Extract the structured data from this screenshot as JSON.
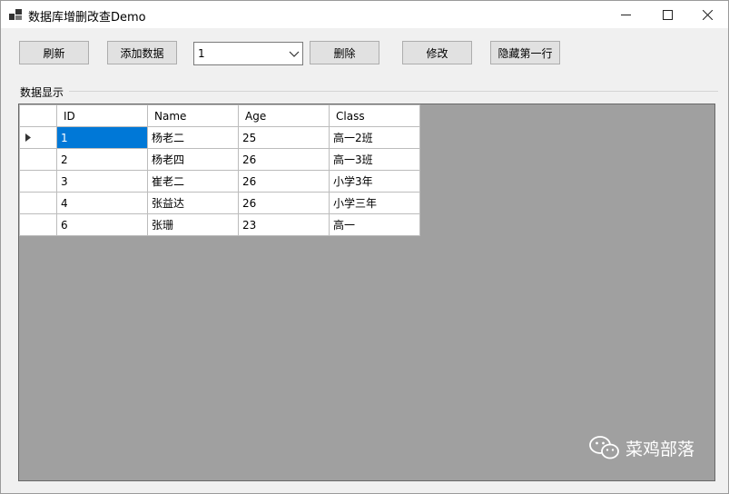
{
  "window": {
    "title": "数据库增删改查Demo"
  },
  "controls": {
    "refresh_label": "刷新",
    "add_label": "添加数据",
    "combo_value": "1",
    "delete_label": "删除",
    "edit_label": "修改",
    "hide_first_label": "隐藏第一行"
  },
  "group": {
    "label": "数据显示"
  },
  "grid": {
    "columns": [
      "ID",
      "Name",
      "Age",
      "Class"
    ],
    "rows": [
      [
        "1",
        "杨老二",
        "25",
        "高一2班"
      ],
      [
        "2",
        "杨老四",
        "26",
        "高一3班"
      ],
      [
        "3",
        "崔老二",
        "26",
        "小学3年"
      ],
      [
        "4",
        "张益达",
        "26",
        "小学三年"
      ],
      [
        "6",
        "张珊",
        "23",
        "高一"
      ]
    ]
  },
  "watermark": {
    "text": "菜鸡部落",
    "icon": "wechat-icon"
  },
  "colors": {
    "selection": "#0078d7",
    "grid_background": "#a0a0a0"
  }
}
